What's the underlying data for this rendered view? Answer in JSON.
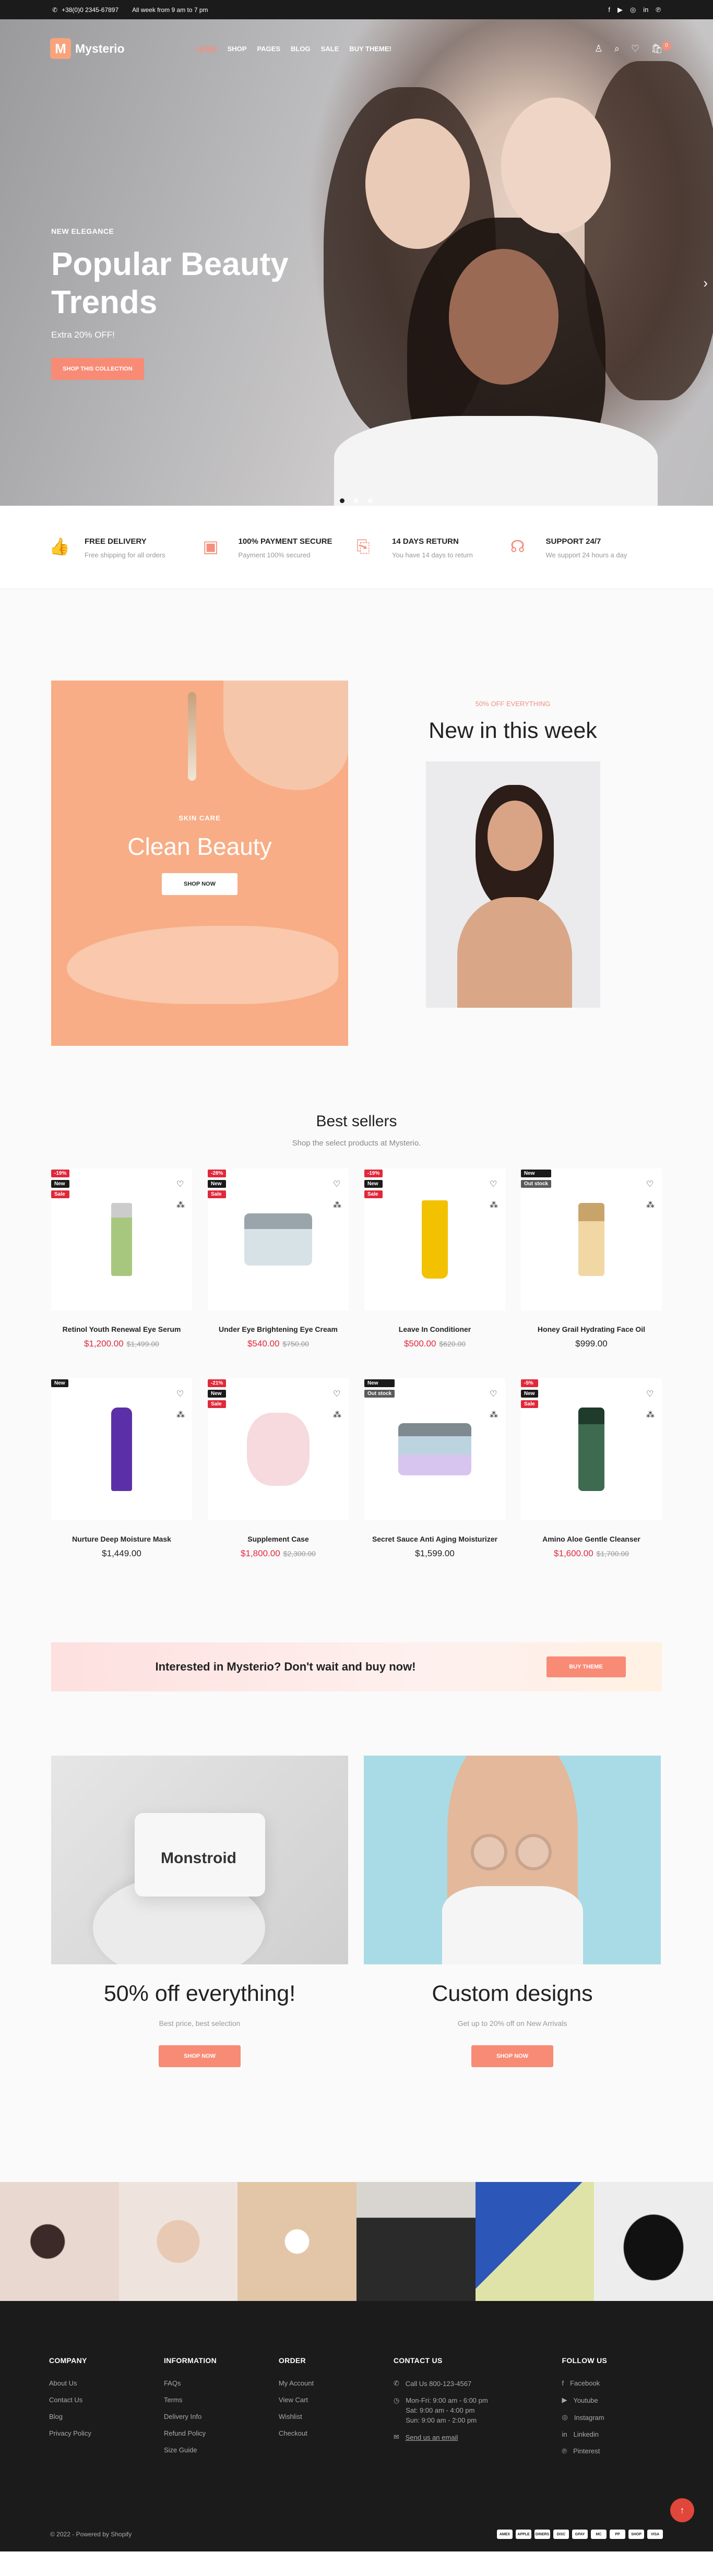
{
  "topbar": {
    "phone": "+38(0)0 2345-67897",
    "hours": "All week from 9 am to 7 pm"
  },
  "nav": {
    "brand": "Mysterio",
    "logo_letter": "M",
    "menu": [
      "HOME",
      "SHOP",
      "PAGES",
      "BLOG",
      "SALE",
      "BUY THEME!"
    ],
    "cart_count": "0"
  },
  "hero": {
    "eyebrow": "NEW ELEGANCE",
    "title": "Popular Beauty Trends",
    "sub": "Extra 20% OFF!",
    "cta": "SHOP THIS COLLECTION"
  },
  "features": [
    {
      "title": "FREE DELIVERY",
      "desc": "Free shipping for all orders"
    },
    {
      "title": "100% PAYMENT SECURE",
      "desc": "Payment 100% secured"
    },
    {
      "title": "14 DAYS RETURN",
      "desc": "You have 14 days to return"
    },
    {
      "title": "SUPPORT 24/7",
      "desc": "We support 24 hours a day"
    }
  ],
  "clean_beauty": {
    "eyebrow": "SKIN CARE",
    "title": "Clean Beauty",
    "cta": "SHOP NOW"
  },
  "new_in": {
    "eyebrow": "50% OFF EVERYTHING",
    "title": "New in this week"
  },
  "bestsellers": {
    "title": "Best sellers",
    "sub": "Shop the select products at Mysterio.",
    "products": [
      {
        "name": "Retinol Youth Renewal Eye Serum",
        "price": "$1,200.00",
        "old": "$1,499.00",
        "badges": [
          "-19%",
          "New",
          "Sale"
        ]
      },
      {
        "name": "Under Eye Brightening Eye Cream",
        "price": "$540.00",
        "old": "$750.00",
        "badges": [
          "-28%",
          "New",
          "Sale"
        ]
      },
      {
        "name": "Leave In Conditioner",
        "price": "$500.00",
        "old": "$620.00",
        "badges": [
          "-19%",
          "New",
          "Sale"
        ]
      },
      {
        "name": "Honey Grail Hydrating Face Oil",
        "price": "$999.00",
        "old": "",
        "badges": [
          "New",
          "Out stock"
        ]
      },
      {
        "name": "Nurture Deep Moisture Mask",
        "price": "$1,449.00",
        "old": "",
        "badges": [
          "New"
        ]
      },
      {
        "name": "Supplement Case",
        "price": "$1,800.00",
        "old": "$2,300.00",
        "badges": [
          "-21%",
          "New",
          "Sale"
        ]
      },
      {
        "name": "Secret Sauce Anti Aging Moisturizer",
        "price": "$1,599.00",
        "old": "",
        "badges": [
          "New",
          "Out stock"
        ]
      },
      {
        "name": "Amino Aloe Gentle Cleanser",
        "price": "$1,600.00",
        "old": "$1,700.00",
        "badges": [
          "-5%",
          "New",
          "Sale"
        ]
      }
    ]
  },
  "cta_banner": {
    "text": "Interested in Mysterio? Don't wait and buy now!",
    "button": "BUY THEME"
  },
  "promos": [
    {
      "title": "50% off everything!",
      "desc": "Best price, best selection",
      "cta": "SHOP NOW",
      "brand": "Monstroid"
    },
    {
      "title": "Custom designs",
      "desc": "Get up to 20% off on New Arrivals",
      "cta": "SHOP NOW"
    }
  ],
  "footer": {
    "company": {
      "title": "COMPANY",
      "items": [
        "About Us",
        "Contact Us",
        "Blog",
        "Privacy Policy"
      ]
    },
    "information": {
      "title": "INFORMATION",
      "items": [
        "FAQs",
        "Terms",
        "Delivery Info",
        "Refund Policy",
        "Size Guide"
      ]
    },
    "order": {
      "title": "ORDER",
      "items": [
        "My Account",
        "View Cart",
        "Wishlist",
        "Checkout"
      ]
    },
    "contact": {
      "title": "CONTACT US",
      "phone": "Call Us 800-123-4567",
      "hours": [
        "Mon-Fri: 9:00 am - 6:00 pm",
        "Sat: 9:00 am - 4:00 pm",
        "Sun: 9:00 am - 2:00 pm"
      ],
      "email": "Send us an email"
    },
    "follow": {
      "title": "FOLLOW US",
      "items": [
        "Facebook",
        "Youtube",
        "Instagram",
        "Linkedin",
        "Pinterest"
      ]
    },
    "copyright": "© 2022 - Powered by Shopify",
    "payments": [
      "AMEX",
      "APPLE",
      "DINERS",
      "DISC",
      "GPAY",
      "MC",
      "PP",
      "SHOP",
      "VISA"
    ]
  }
}
